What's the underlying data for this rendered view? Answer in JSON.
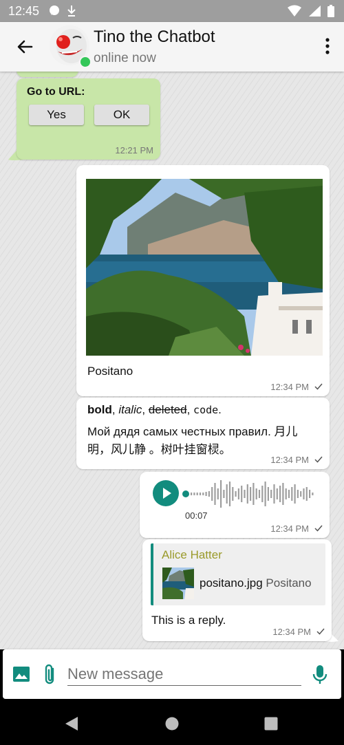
{
  "status_bar": {
    "time": "12:45"
  },
  "header": {
    "title": "Tino the Chatbot",
    "status": "online now"
  },
  "messages": {
    "goto": {
      "label": "Go to URL:",
      "yes": "Yes",
      "ok": "OK",
      "time": "12:21 PM"
    },
    "photo": {
      "caption": "Positano",
      "time": "12:34 PM"
    },
    "rich": {
      "bold": "bold",
      "sep1": ", ",
      "italic": "italic",
      "sep2": ", ",
      "deleted": "deleted",
      "sep3": ", ",
      "code": "code",
      "end": ".",
      "line2": "Мой дядя самых честных правил. 月儿",
      "line3": "明，风儿静 。树叶挂窗棂。",
      "time": "12:34 PM"
    },
    "audio": {
      "duration": "00:07",
      "time": "12:34 PM"
    },
    "reply": {
      "quote_author": "Alice Hatter",
      "quote_file": "positano.jpg",
      "quote_caption": "Positano",
      "text": "This is a reply.",
      "time": "12:34 PM"
    }
  },
  "composer": {
    "placeholder": "New message"
  },
  "colors": {
    "accent": "#128c7e",
    "incoming": "#c8e6a8",
    "quote_author": "#9a9a2a",
    "online": "#34c759"
  }
}
